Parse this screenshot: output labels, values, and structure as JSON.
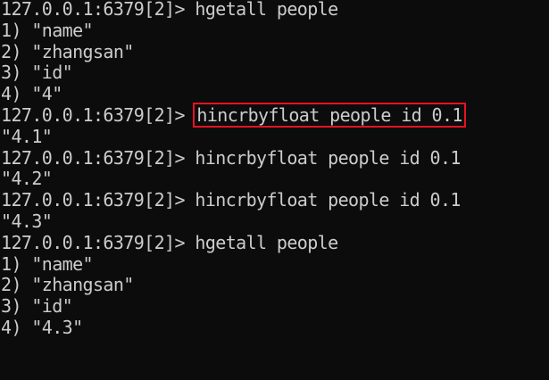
{
  "terminal": {
    "lines": [
      {
        "prompt": "127.0.0.1:6379[2]> ",
        "command": "hgetall people",
        "output": ""
      },
      {
        "prompt": "",
        "command": "",
        "output": "1) \"name\""
      },
      {
        "prompt": "",
        "command": "",
        "output": "2) \"zhangsan\""
      },
      {
        "prompt": "",
        "command": "",
        "output": "3) \"id\""
      },
      {
        "prompt": "",
        "command": "",
        "output": "4) \"4\""
      },
      {
        "prompt": "127.0.0.1:6379[2]> ",
        "command": "hincrbyfloat people id 0.1",
        "output": ""
      },
      {
        "prompt": "",
        "command": "",
        "output": "\"4.1\""
      },
      {
        "prompt": "127.0.0.1:6379[2]> ",
        "command": "hincrbyfloat people id 0.1",
        "output": ""
      },
      {
        "prompt": "",
        "command": "",
        "output": "\"4.2\""
      },
      {
        "prompt": "127.0.0.1:6379[2]> ",
        "command": "hincrbyfloat people id 0.1",
        "output": ""
      },
      {
        "prompt": "",
        "command": "",
        "output": "\"4.3\""
      },
      {
        "prompt": "127.0.0.1:6379[2]> ",
        "command": "hgetall people",
        "output": ""
      },
      {
        "prompt": "",
        "command": "",
        "output": "1) \"name\""
      },
      {
        "prompt": "",
        "command": "",
        "output": "2) \"zhangsan\""
      },
      {
        "prompt": "",
        "command": "",
        "output": "3) \"id\""
      },
      {
        "prompt": "",
        "command": "",
        "output": "4) \"4.3\""
      }
    ],
    "highlighted_command": "hincrbyfloat people id 0.1",
    "colors": {
      "background": "#0c0c0c",
      "text": "#cccccc",
      "highlight_border": "#e81123"
    }
  }
}
